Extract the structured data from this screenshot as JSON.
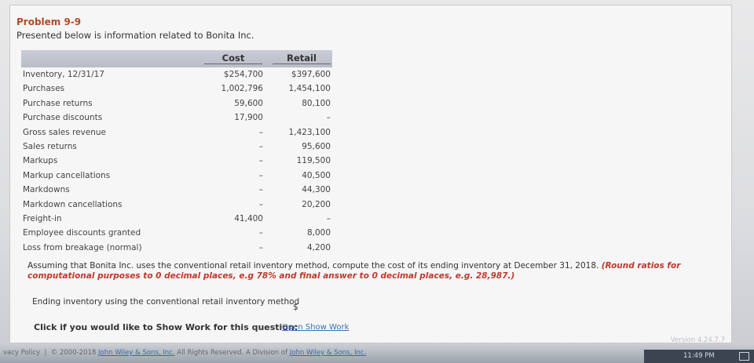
{
  "problem": {
    "title": "Problem 9-9",
    "intro": "Presented below is information related to Bonita Inc."
  },
  "table": {
    "headers": {
      "cost": "Cost",
      "retail": "Retail"
    },
    "rows": [
      {
        "label": "Inventory, 12/31/17",
        "cost": "$254,700",
        "retail": "$397,600"
      },
      {
        "label": "Purchases",
        "cost": "1,002,796",
        "retail": "1,454,100"
      },
      {
        "label": "Purchase returns",
        "cost": "59,600",
        "retail": "80,100"
      },
      {
        "label": "Purchase discounts",
        "cost": "17,900",
        "retail": "–"
      },
      {
        "label": "Gross sales revenue",
        "cost": "–",
        "retail": "1,423,100"
      },
      {
        "label": "Sales returns",
        "cost": "–",
        "retail": "95,600"
      },
      {
        "label": "Markups",
        "cost": "–",
        "retail": "119,500"
      },
      {
        "label": "Markup cancellations",
        "cost": "–",
        "retail": "40,500"
      },
      {
        "label": "Markdowns",
        "cost": "–",
        "retail": "44,300"
      },
      {
        "label": "Markdown cancellations",
        "cost": "–",
        "retail": "20,200"
      },
      {
        "label": "Freight-in",
        "cost": "41,400",
        "retail": "–"
      },
      {
        "label": "Employee discounts granted",
        "cost": "–",
        "retail": "8,000"
      },
      {
        "label": "Loss from breakage (normal)",
        "cost": "–",
        "retail": "4,200"
      }
    ]
  },
  "question": {
    "text": "Assuming that Bonita Inc. uses the conventional retail inventory method, compute the cost of its ending inventory at December 31, 2018.",
    "hint": "(Round ratios for computational purposes to 0 decimal places, e.g 78% and final answer to 0 decimal places, e.g. 28,987.)"
  },
  "answer": {
    "label": "Ending inventory using the conventional retail inventory method",
    "currency": "$",
    "value": ""
  },
  "show_work": {
    "label": "Click if you would like to Show Work for this question:",
    "link": "Open Show Work"
  },
  "version": "Version 4.24.7.7",
  "footer": {
    "privacy": "vacy Policy",
    "separator": "|",
    "copyright": "© 2000-2018",
    "company_link": "John Wiley & Sons, Inc.",
    "rights": "All Rights Reserved. A Division of",
    "company_link2": "John Wiley & Sons, Inc."
  },
  "taskbar": {
    "clock": "11:49 PM"
  }
}
